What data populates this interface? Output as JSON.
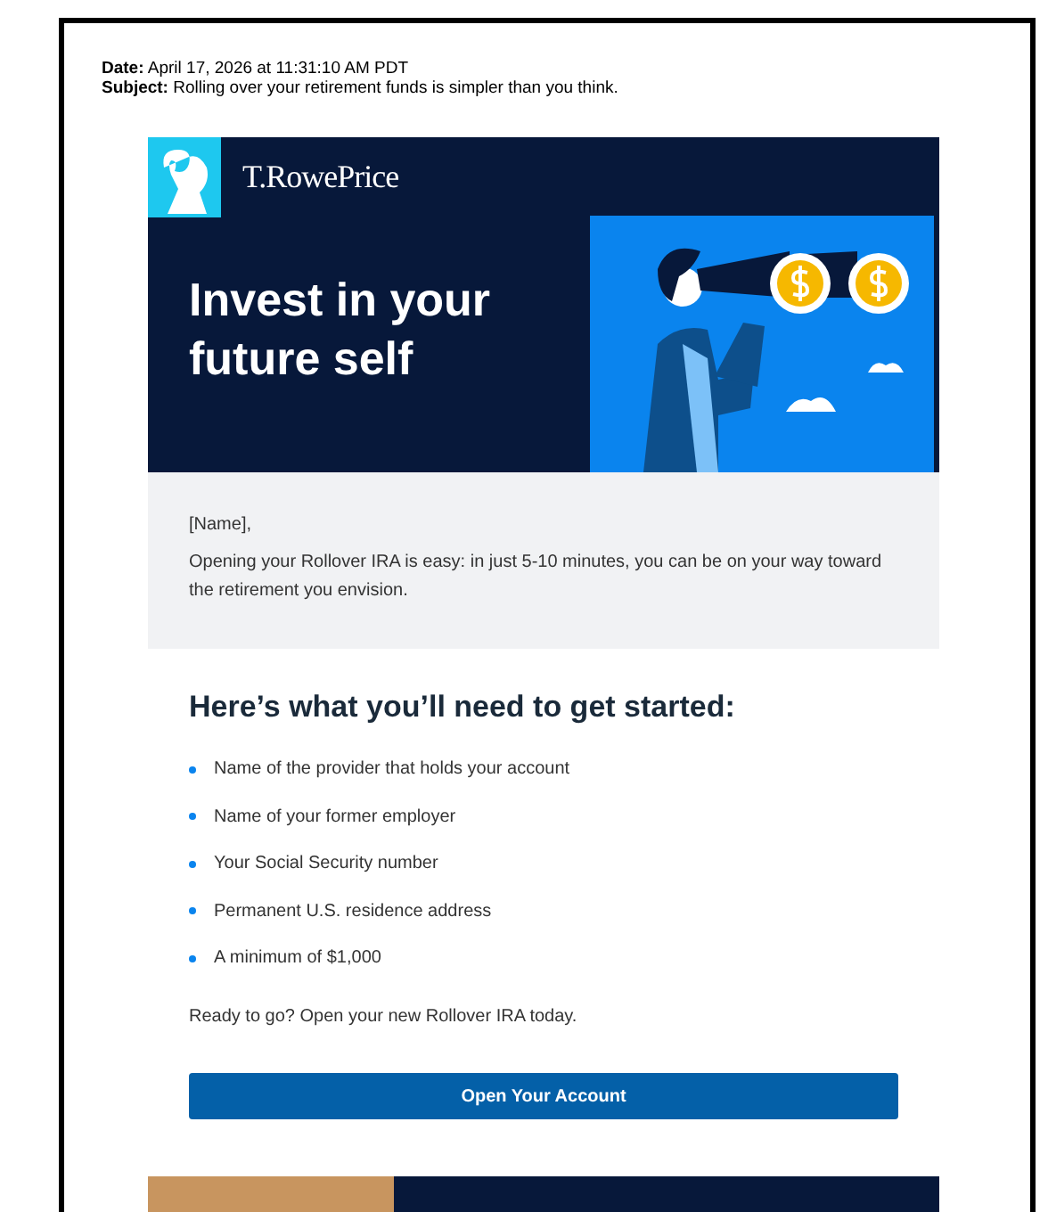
{
  "header": {
    "date_label": "Date:",
    "date": "April 17, 2026 at 11:31:10 AM PDT",
    "subject_label": "Subject:",
    "subject": "Rolling over your retirement funds is simpler than you think."
  },
  "brand": {
    "name": "T.RowePrice"
  },
  "hero": {
    "title": "Invest in your future self"
  },
  "intro": {
    "greeting": "[Name],",
    "body": "Opening your Rollover IRA is easy: in just 5-10 minutes, you can be on your way toward the retirement you envision."
  },
  "checklist": {
    "heading": "Here’s what you’ll need to get started:",
    "items": [
      "Name of the provider that holds your account",
      "Name of your former employer",
      "Your Social Security number",
      "Permanent U.S. residence address",
      "A minimum of $1,000"
    ]
  },
  "cta": {
    "prompt": "Ready to go? Open your new Rollover IRA today.",
    "button": "Open Your Account"
  }
}
